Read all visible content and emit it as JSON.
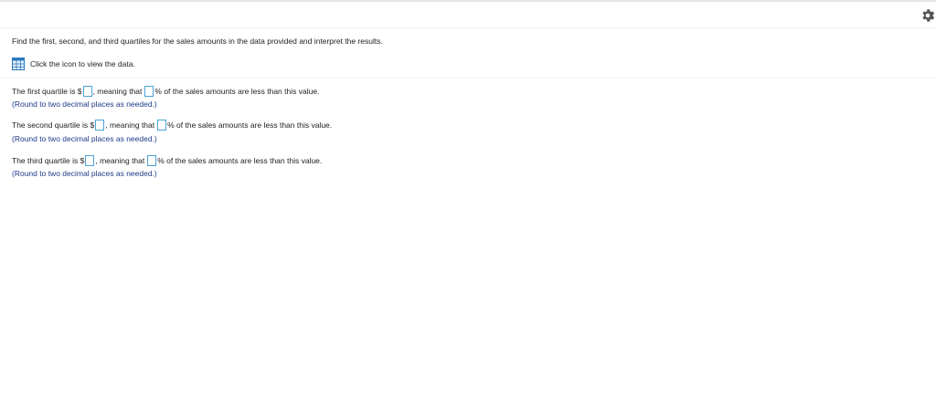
{
  "question": {
    "text": "Find the first, second, and third quartiles for the sales amounts in the data provided and interpret the results."
  },
  "data_link": {
    "label": "Click the icon to view the data.",
    "icon": "table-icon"
  },
  "toolbar": {
    "settings_icon": "gear-icon"
  },
  "answers": [
    {
      "prefix": "The first quartile is $",
      "middle": ", meaning that",
      "suffix": "% of the sales amounts are less than this value.",
      "hint": "(Round to two decimal places as needed.)",
      "value": "",
      "percent": ""
    },
    {
      "prefix": "The second quartile is $",
      "middle": ", meaning that",
      "suffix": "% of the sales amounts are less than this value.",
      "hint": "(Round to two decimal places as needed.)",
      "value": "",
      "percent": ""
    },
    {
      "prefix": "The third quartile is $",
      "middle": ", meaning that",
      "suffix": "% of the sales amounts are less than this value.",
      "hint": "(Round to two decimal places as needed.)",
      "value": "",
      "percent": ""
    }
  ],
  "colors": {
    "hint": "#1f3a8a",
    "input_border": "#4aa3d8",
    "icon_blue": "#2a78c2"
  }
}
